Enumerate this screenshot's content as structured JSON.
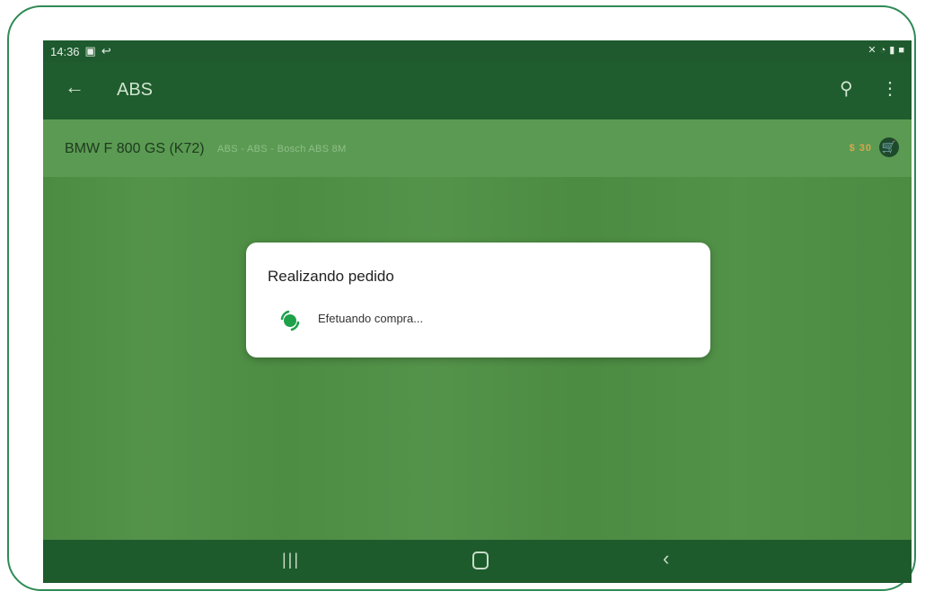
{
  "status_bar": {
    "time": "14:36"
  },
  "app_bar": {
    "title": "ABS"
  },
  "product": {
    "name": "BMW F 800 GS (K72)",
    "description": "ABS - ABS - Bosch ABS 8M",
    "price": "$ 30"
  },
  "dialog": {
    "title": "Realizando pedido",
    "message": "Efetuando compra..."
  },
  "colors": {
    "primary_dark": "#1e5a2e",
    "accent": "#1fa14a",
    "price": "#d9a64a"
  }
}
